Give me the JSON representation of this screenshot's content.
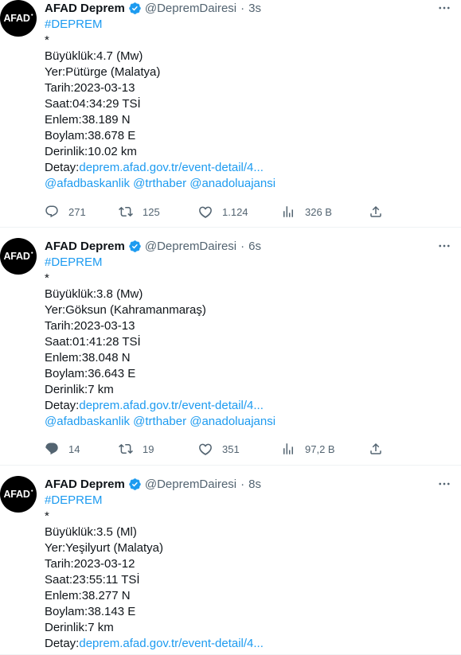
{
  "tweets": [
    {
      "avatar_text": "AFAD",
      "name": "AFAD Deprem",
      "handle": "@DepremDairesi",
      "time": "3s",
      "hashtag": "#DEPREM",
      "asterisk": "*",
      "magnitude_label": "Büyüklük:",
      "magnitude": "4.7 (Mw)",
      "place_label": "Yer:",
      "place": "Pütürge (Malatya)",
      "date_label": "Tarih:",
      "date": "2023-03-13",
      "hour_label": "Saat:",
      "hour": "04:34:29 TSİ",
      "lat_label": "Enlem:",
      "lat": "38.189 N",
      "lon_label": "Boylam:",
      "lon": "38.678 E",
      "depth_label": "Derinlik:",
      "depth": "10.02 km",
      "detail_label": "Detay:",
      "detail_link": "deprem.afad.gov.tr/event-detail/4...",
      "mentions": [
        "@afadbaskanlik",
        "@trthaber",
        "@anadoluajansi"
      ],
      "replies": "271",
      "retweets": "125",
      "likes": "1.124",
      "views": "326 B"
    },
    {
      "avatar_text": "AFAD",
      "name": "AFAD Deprem",
      "handle": "@DepremDairesi",
      "time": "6s",
      "hashtag": "#DEPREM",
      "asterisk": "*",
      "magnitude_label": "Büyüklük:",
      "magnitude": "3.8 (Mw)",
      "place_label": "Yer:",
      "place": "Göksun (Kahramanmaraş)",
      "date_label": "Tarih:",
      "date": "2023-03-13",
      "hour_label": "Saat:",
      "hour": "01:41:28 TSİ",
      "lat_label": "Enlem:",
      "lat": "38.048 N",
      "lon_label": "Boylam:",
      "lon": "36.643 E",
      "depth_label": "Derinlik:",
      "depth": "7 km",
      "detail_label": "Detay:",
      "detail_link": "deprem.afad.gov.tr/event-detail/4...",
      "mentions": [
        "@afadbaskanlik",
        "@trthaber",
        "@anadoluajansi"
      ],
      "replies": "14",
      "retweets": "19",
      "likes": "351",
      "views": "97,2 B"
    },
    {
      "avatar_text": "AFAD",
      "name": "AFAD Deprem",
      "handle": "@DepremDairesi",
      "time": "8s",
      "hashtag": "#DEPREM",
      "asterisk": "*",
      "magnitude_label": "Büyüklük:",
      "magnitude": "3.5 (Ml)",
      "place_label": "Yer:",
      "place": "Yeşilyurt (Malatya)",
      "date_label": "Tarih:",
      "date": "2023-03-12",
      "hour_label": "Saat:",
      "hour": "23:55:11 TSİ",
      "lat_label": "Enlem:",
      "lat": "38.277 N",
      "lon_label": "Boylam:",
      "lon": "38.143 E",
      "depth_label": "Derinlik:",
      "depth": "7 km",
      "detail_label": "Detay:",
      "detail_link": "deprem.afad.gov.tr/event-detail/4..."
    }
  ],
  "colors": {
    "link": "#1d9bf0",
    "secondary": "#536471",
    "text": "#0f1419"
  },
  "icons": [
    "verified-badge-icon",
    "more-icon",
    "reply-icon",
    "retweet-icon",
    "like-icon",
    "views-icon",
    "share-icon"
  ]
}
